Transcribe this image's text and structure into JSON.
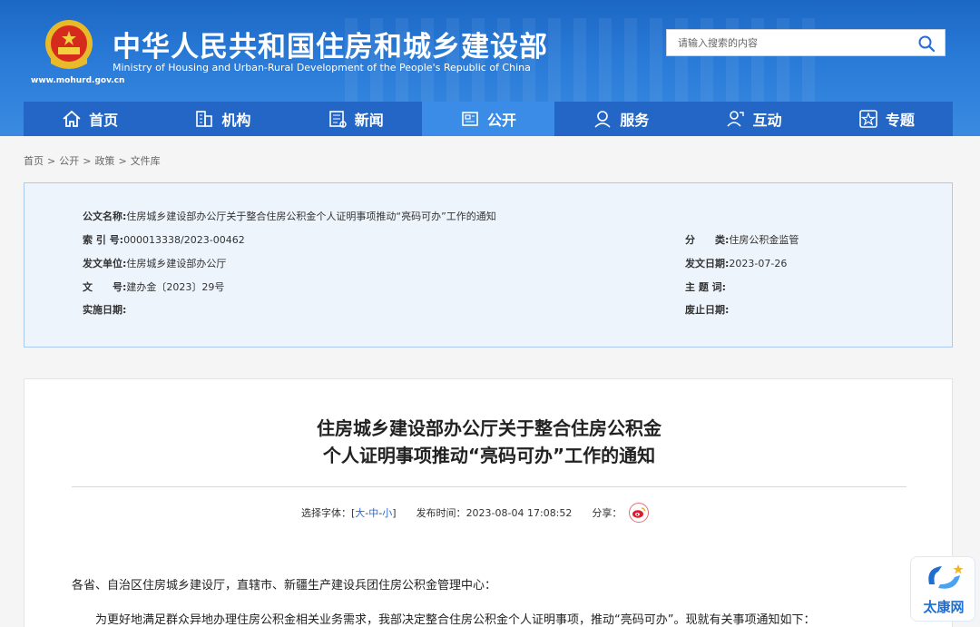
{
  "header": {
    "title": "中华人民共和国住房和城乡建设部",
    "subtitle": "Ministry of Housing and Urban-Rural Development of the People's Republic of China",
    "url": "www.mohurd.gov.cn",
    "search_placeholder": "请输入搜索的内容",
    "search_icon": "search-icon"
  },
  "nav": {
    "items": [
      {
        "label": "首页",
        "icon": "home-icon"
      },
      {
        "label": "机构",
        "icon": "building-icon"
      },
      {
        "label": "新闻",
        "icon": "news-icon"
      },
      {
        "label": "公开",
        "icon": "document-icon"
      },
      {
        "label": "服务",
        "icon": "service-icon"
      },
      {
        "label": "互动",
        "icon": "interaction-icon"
      },
      {
        "label": "专题",
        "icon": "star-icon"
      }
    ],
    "active_index": 3
  },
  "breadcrumb": [
    "首页",
    "公开",
    "政策",
    "文件库"
  ],
  "breadcrumb_sep": ">",
  "info": {
    "name_label": "公文名称:",
    "name_value": "住房城乡建设部办公厅关于整合住房公积金个人证明事项推动“亮码可办”工作的通知",
    "index_label": "索 引 号:",
    "index_value": "000013338/2023-00462",
    "category_label": "分　　类:",
    "category_value": "住房公积金监管",
    "issuer_label": "发文单位:",
    "issuer_value": "住房城乡建设部办公厅",
    "date_label": "发文日期:",
    "date_value": "2023-07-26",
    "docno_label": "文　　号:",
    "docno_value": "建办金〔2023〕29号",
    "subject_label": "主 题 词:",
    "subject_value": "",
    "effective_label": "实施日期:",
    "effective_value": "",
    "expire_label": "废止日期:",
    "expire_value": ""
  },
  "article": {
    "title_line1": "住房城乡建设部办公厅关于整合住房公积金",
    "title_line2": "个人证明事项推动“亮码可办”工作的通知",
    "font_label": "选择字体：[",
    "font_large": "大",
    "font_mid": "中",
    "font_small": "小",
    "font_dash": "-",
    "font_close": "]",
    "publish_label": "发布时间：",
    "publish_time": "2023-08-04 17:08:52",
    "share_label": "分享：",
    "salutation": "各省、自治区住房城乡建设厅，直辖市、新疆生产建设兵团住房公积金管理中心：",
    "para1": "为更好地满足群众异地办理住房公积金相关业务需求，我部决定整合住房公积金个人证明事项，推动“亮码可办”。现就有关事项通知如下："
  },
  "watermark": {
    "text": "太康网"
  },
  "colors": {
    "header_blue": "#2a7bd8",
    "nav_blue": "#2466c5",
    "nav_active": "#3a8ce6",
    "link_blue": "#2a6ad6"
  }
}
